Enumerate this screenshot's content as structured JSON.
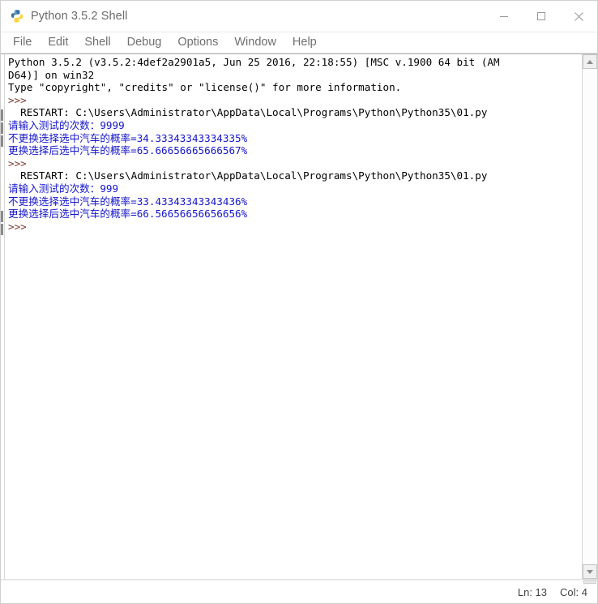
{
  "window": {
    "title": "Python 3.5.2 Shell",
    "icon": "python-logo-icon",
    "minimize_label": "—",
    "maximize_label": "□",
    "close_label": "✕"
  },
  "menubar": {
    "items": [
      {
        "label": "File"
      },
      {
        "label": "Edit"
      },
      {
        "label": "Shell"
      },
      {
        "label": "Debug"
      },
      {
        "label": "Options"
      },
      {
        "label": "Window"
      },
      {
        "label": "Help"
      }
    ]
  },
  "console": {
    "lines": [
      {
        "text": "Python 3.5.2 (v3.5.2:4def2a2901a5, Jun 25 2016, 22:18:55) [MSC v.1900 64 bit (AM",
        "color": "black"
      },
      {
        "text": "D64)] on win32",
        "color": "black"
      },
      {
        "text": "Type \"copyright\", \"credits\" or \"license()\" for more information.",
        "color": "black"
      },
      {
        "text": ">>> ",
        "color": "prompt"
      },
      {
        "text": "  RESTART: C:\\Users\\Administrator\\AppData\\Local\\Programs\\Python\\Python35\\01.py",
        "color": "restart"
      },
      {
        "text": "请输入测试的次数：9999",
        "color": "blue"
      },
      {
        "text": "不更换选择选中汽车的概率=34.33343343334335%",
        "color": "blue"
      },
      {
        "text": "更换选择后选中汽车的概率=65.66656665666567%",
        "color": "blue"
      },
      {
        "text": ">>> ",
        "color": "prompt"
      },
      {
        "text": "  RESTART: C:\\Users\\Administrator\\AppData\\Local\\Programs\\Python\\Python35\\01.py",
        "color": "restart"
      },
      {
        "text": "请输入测试的次数：999",
        "color": "blue"
      },
      {
        "text": "不更换选择选中汽车的概率=33.43343343343436%",
        "color": "blue"
      },
      {
        "text": "更换选择后选中汽车的概率=66.56656656656656%",
        "color": "blue"
      },
      {
        "text": ">>> ",
        "color": "prompt"
      }
    ]
  },
  "scrollbar": {
    "up_arrow": "scroll-up-arrow-icon",
    "down_arrow": "scroll-down-arrow-icon"
  },
  "statusbar": {
    "line_label": "Ln: 13",
    "col_label": "Col: 4"
  },
  "colors": {
    "output_blue": "#1515cc",
    "prompt_brown": "#7b3a2e",
    "text_black": "#000000",
    "menu_gray": "#6f6f6f",
    "title_gray": "#6b6b6b"
  }
}
